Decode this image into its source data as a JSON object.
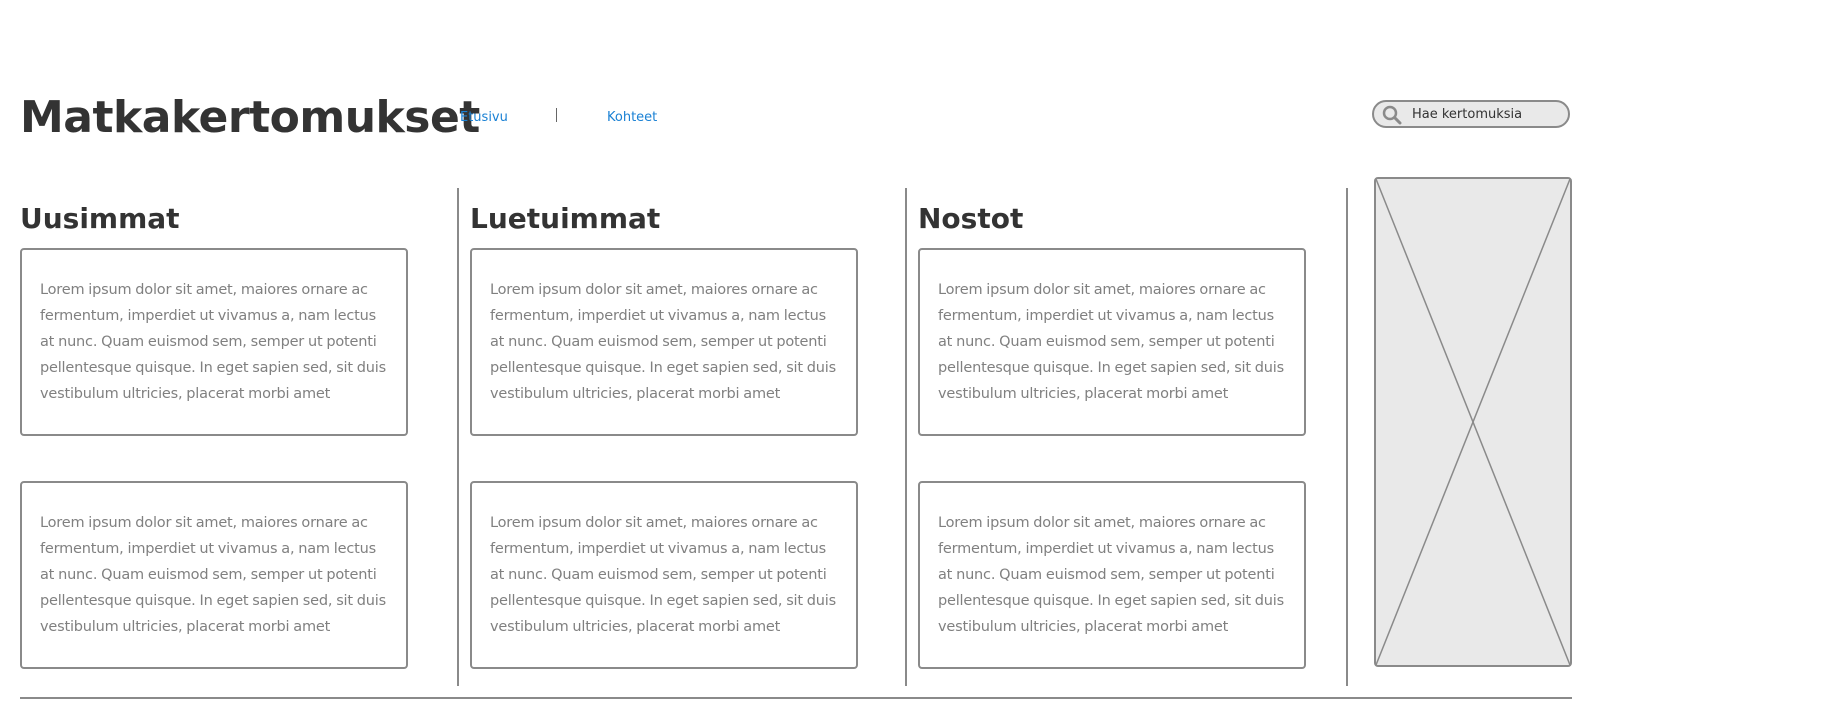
{
  "header": {
    "title": "Matkakertomukset",
    "nav": [
      {
        "label": "Etusivu"
      },
      {
        "label": "Kohteet"
      }
    ],
    "search": {
      "placeholder": "Hae kertomuksia",
      "icon": "search-icon"
    }
  },
  "columns": [
    {
      "heading": "Uusimmat",
      "cards": [
        {
          "text": "Lorem ipsum dolor sit amet, maiores ornare ac fermentum, imperdiet ut vivamus a, nam lectus at nunc. Quam euismod sem, semper ut potenti pellentesque quisque. In eget sapien sed, sit duis vestibulum ultricies, placerat morbi amet"
        },
        {
          "text": "Lorem ipsum dolor sit amet, maiores ornare ac fermentum, imperdiet ut vivamus a, nam lectus at nunc. Quam euismod sem, semper ut potenti pellentesque quisque. In eget sapien sed, sit duis vestibulum ultricies, placerat morbi amet"
        }
      ]
    },
    {
      "heading": "Luetuimmat",
      "cards": [
        {
          "text": "Lorem ipsum dolor sit amet, maiores ornare ac fermentum, imperdiet ut vivamus a, nam lectus at nunc. Quam euismod sem, semper ut potenti pellentesque quisque. In eget sapien sed, sit duis vestibulum ultricies, placerat morbi amet"
        },
        {
          "text": "Lorem ipsum dolor sit amet, maiores ornare ac fermentum, imperdiet ut vivamus a, nam lectus at nunc. Quam euismod sem, semper ut potenti pellentesque quisque. In eget sapien sed, sit duis vestibulum ultricies, placerat morbi amet"
        }
      ]
    },
    {
      "heading": "Nostot",
      "cards": [
        {
          "text": "Lorem ipsum dolor sit amet, maiores ornare ac fermentum, imperdiet ut vivamus a, nam lectus at nunc. Quam euismod sem, semper ut potenti pellentesque quisque. In eget sapien sed, sit duis vestibulum ultricies, placerat morbi amet"
        },
        {
          "text": "Lorem ipsum dolor sit amet, maiores ornare ac fermentum, imperdiet ut vivamus a, nam lectus at nunc. Quam euismod sem, semper ut potenti pellentesque quisque. In eget sapien sed, sit duis vestibulum ultricies, placerat morbi amet"
        }
      ]
    }
  ],
  "sidebar": {
    "placeholder_icon": "image-placeholder-icon"
  },
  "colors": {
    "title": "#333333",
    "link": "#1a81d4",
    "border": "#8a8a8a",
    "body_text": "#808080",
    "placeholder_fill": "#e9e9e9"
  }
}
